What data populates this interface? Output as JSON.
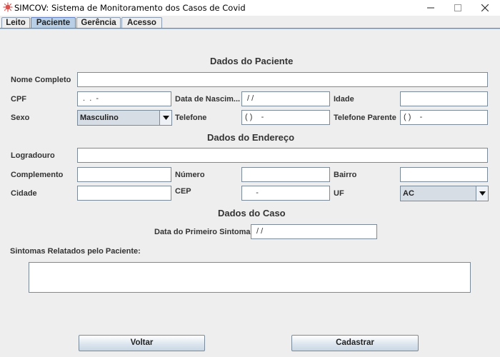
{
  "window": {
    "title": "SIMCOV: Sistema de Monitoramento dos Casos de Covid"
  },
  "tabs": [
    {
      "label": "Leito"
    },
    {
      "label": "Paciente"
    },
    {
      "label": "Gerência"
    },
    {
      "label": "Acesso"
    }
  ],
  "paciente": {
    "title": "Dados do Paciente",
    "nome_label": "Nome Completo",
    "nome_value": "",
    "cpf_label": "CPF",
    "cpf_value": " .  .  -",
    "nascimento_label": "Data de Nascim...",
    "nascimento_value": " / /",
    "idade_label": "Idade",
    "idade_value": "",
    "sexo_label": "Sexo",
    "sexo_value": "Masculino",
    "telefone_label": "Telefone",
    "telefone_value": "( )    -",
    "telefone_parente_label": "Telefone Parente",
    "telefone_parente_value": "( )    -"
  },
  "endereco": {
    "title": "Dados do Endereço",
    "logradouro_label": "Logradouro",
    "logradouro_value": "",
    "complemento_label": "Complemento",
    "complemento_value": "",
    "numero_label": "Número",
    "numero_value": "",
    "bairro_label": "Bairro",
    "bairro_value": "",
    "cidade_label": "Cidade",
    "cidade_value": "",
    "cep_label": "CEP",
    "cep_value": "     -",
    "uf_label": "UF",
    "uf_value": "AC"
  },
  "caso": {
    "title": "Dados do Caso",
    "primeiro_sintoma_label": "Data do Primeiro Sintoma:",
    "primeiro_sintoma_value": " / /",
    "sintomas_label": "Sintomas Relatados pelo Paciente:",
    "sintomas_value": ""
  },
  "buttons": {
    "voltar": "Voltar",
    "cadastrar": "Cadastrar"
  }
}
